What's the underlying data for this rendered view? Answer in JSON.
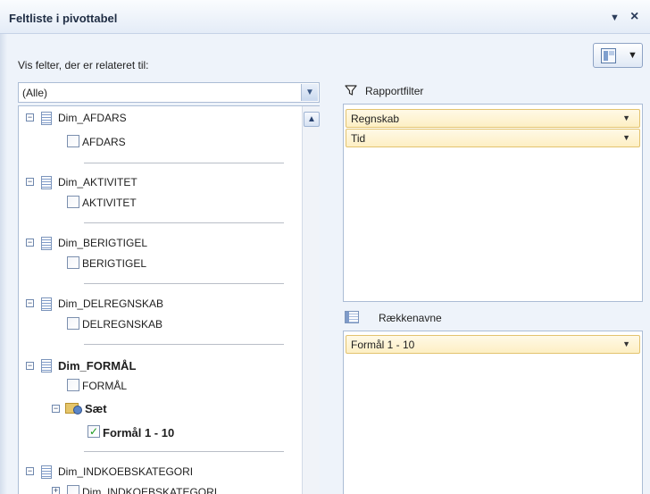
{
  "header": {
    "title": "Feltliste i pivottabel",
    "dropdown_glyph": "▼",
    "close_glyph": "×"
  },
  "layout_button": {
    "icon": "field-list-layout-icon",
    "arrow": "▼"
  },
  "related": {
    "label": "Vis felter, der er relateret til:",
    "selected": "(Alle)",
    "arrow": "▼"
  },
  "scroll": {
    "up": "▲"
  },
  "fields": {
    "afdars": {
      "expander": "−",
      "table": "Dim_AFDARS",
      "field": "AFDARS",
      "checked": false
    },
    "aktivitet": {
      "expander": "−",
      "table": "Dim_AKTIVITET",
      "field": "AKTIVITET",
      "checked": false
    },
    "berigtigel": {
      "expander": "−",
      "table": "Dim_BERIGTIGEL",
      "field": "BERIGTIGEL",
      "checked": false
    },
    "delregnskab": {
      "expander": "−",
      "table": "Dim_DELREGNSKAB",
      "field": "DELREGNSKAB",
      "checked": false
    },
    "formaal": {
      "expander": "−",
      "table": "Dim_FORMÅL",
      "field": "FORMÅL",
      "checked": false,
      "set": {
        "expander": "−",
        "label": "Sæt",
        "item": "Formål 1 - 10",
        "checked": true,
        "check_glyph": "✓"
      }
    },
    "indkoeb": {
      "expander": "−",
      "table": "Dim_INDKOEBSKATEGORI",
      "sub_expander": "+",
      "field": "Dim_INDKOEBSKATEGORI"
    }
  },
  "areas": {
    "report_filter": {
      "label": "Rapportfilter",
      "items": [
        "Regnskab",
        "Tid"
      ],
      "arrow": "▼"
    },
    "row_labels": {
      "label": "Rækkenavne",
      "items": [
        "Formål 1 - 10"
      ],
      "arrow": "▼"
    }
  },
  "colors": {
    "panel_bg": "#eef3fa",
    "border": "#abbcd5",
    "pill_bg": "#fdefc4",
    "pill_border": "#e3c36f",
    "check": "#1a9b1a"
  }
}
